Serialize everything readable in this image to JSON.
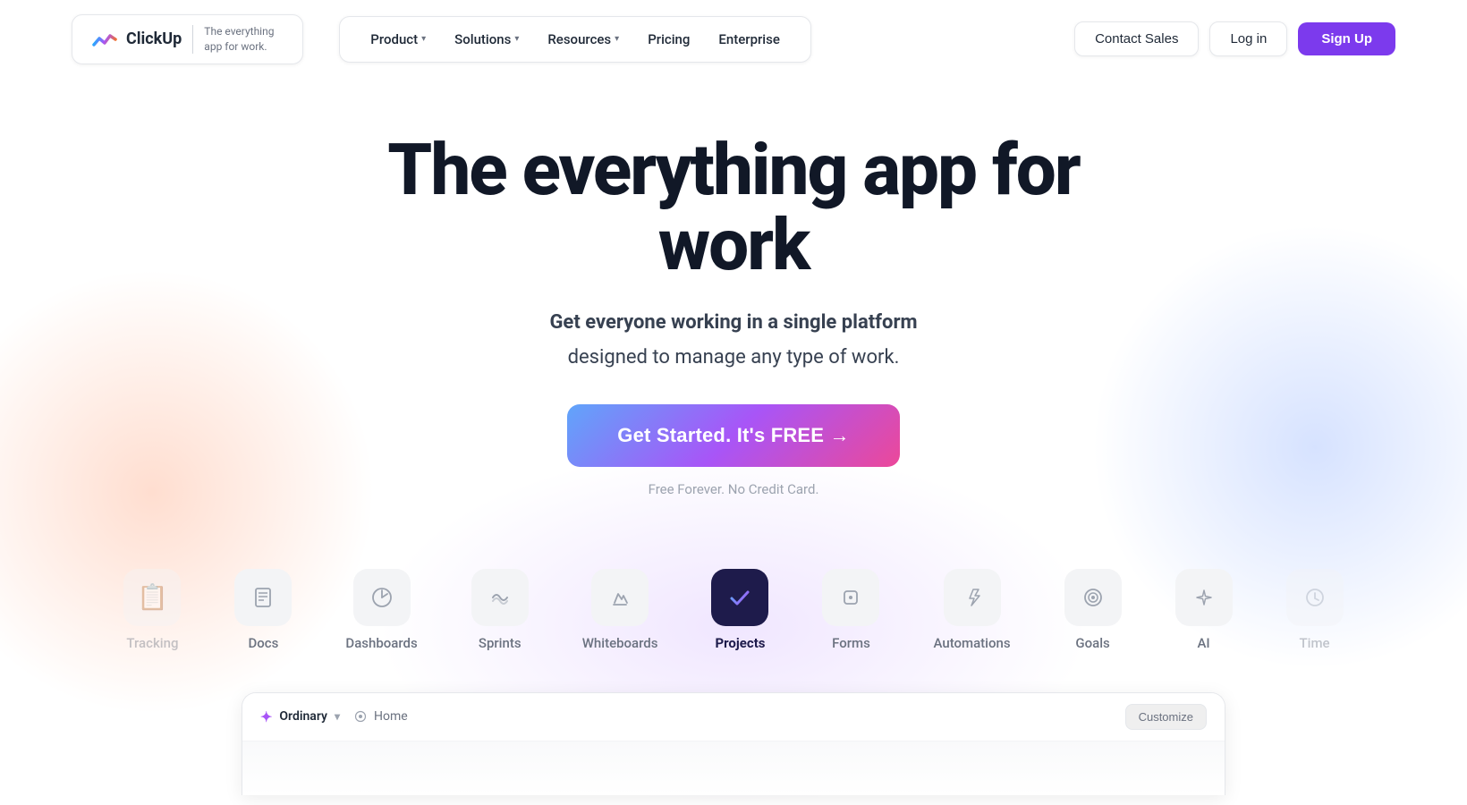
{
  "navbar": {
    "logo": {
      "name": "ClickUp",
      "tagline": "The everything\napp for work."
    },
    "links": [
      {
        "label": "Product",
        "hasDropdown": true
      },
      {
        "label": "Solutions",
        "hasDropdown": true
      },
      {
        "label": "Resources",
        "hasDropdown": true
      },
      {
        "label": "Pricing",
        "hasDropdown": false
      },
      {
        "label": "Enterprise",
        "hasDropdown": false
      }
    ],
    "contact_sales": "Contact Sales",
    "login": "Log in",
    "signup": "Sign Up"
  },
  "hero": {
    "title": "The everything app for work",
    "subtitle_bold": "Get everyone working in a single platform",
    "subtitle_regular": "designed to manage any type of work.",
    "cta_label": "Get Started. It's FREE →",
    "fine_print": "Free Forever. No Credit Card."
  },
  "features": [
    {
      "id": "tracking",
      "label": "Tracking",
      "icon": "📋",
      "active": false,
      "faded": true
    },
    {
      "id": "docs",
      "label": "Docs",
      "icon": "📄",
      "active": false,
      "faded": false
    },
    {
      "id": "dashboards",
      "label": "Dashboards",
      "icon": "🎯",
      "active": false,
      "faded": false
    },
    {
      "id": "sprints",
      "label": "Sprints",
      "icon": "〰",
      "active": false,
      "faded": false
    },
    {
      "id": "whiteboards",
      "label": "Whiteboards",
      "icon": "✏️",
      "active": false,
      "faded": false
    },
    {
      "id": "projects",
      "label": "Projects",
      "icon": "✓",
      "active": true,
      "faded": false
    },
    {
      "id": "forms",
      "label": "Forms",
      "icon": "⊡",
      "active": false,
      "faded": false
    },
    {
      "id": "automations",
      "label": "Automations",
      "icon": "⚡",
      "active": false,
      "faded": false
    },
    {
      "id": "goals",
      "label": "Goals",
      "icon": "◎",
      "active": false,
      "faded": false
    },
    {
      "id": "ai",
      "label": "AI",
      "icon": "✦",
      "active": false,
      "faded": false
    },
    {
      "id": "time",
      "label": "Time",
      "icon": "⏱",
      "active": false,
      "faded": true
    }
  ],
  "app_preview": {
    "workspace": "Ordinary",
    "breadcrumb": "Home",
    "customize": "Customize"
  }
}
